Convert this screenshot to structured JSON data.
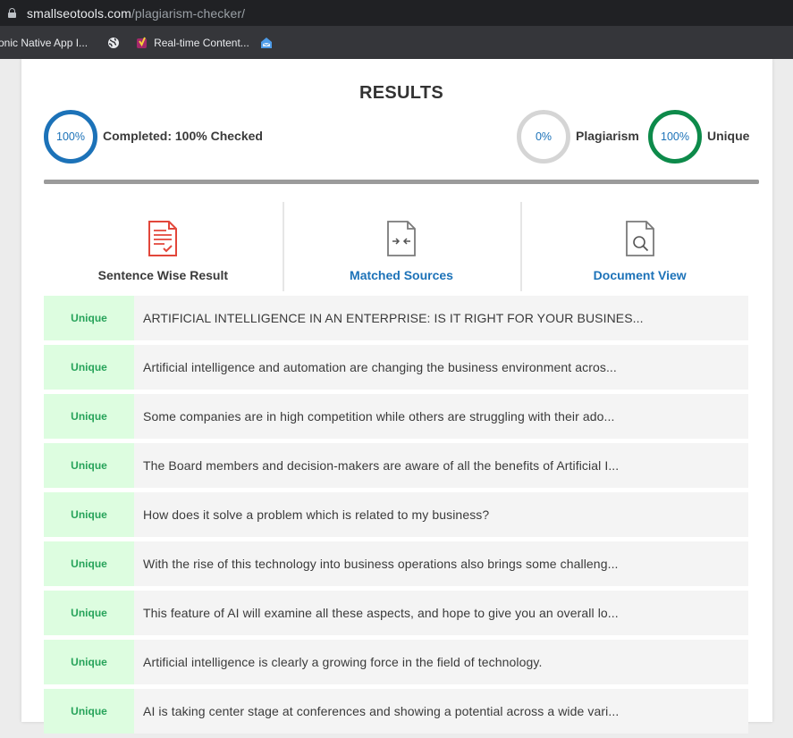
{
  "browser": {
    "url_host": "smallseotools.com",
    "url_path": "/plagiarism-checker/",
    "bookmarks": [
      {
        "label": "onic Native App I...",
        "icon": "none"
      },
      {
        "label": "",
        "icon": "globe-icon"
      },
      {
        "label": "Real-time Content...",
        "icon": "yoast-icon"
      },
      {
        "label": "",
        "icon": "inbox-icon"
      }
    ]
  },
  "results": {
    "title": "RESULTS",
    "completed": {
      "percent_text": "100%",
      "label": "Completed: 100% Checked"
    },
    "plagiarism": {
      "percent_text": "0%",
      "label": "Plagiarism"
    },
    "unique": {
      "percent_text": "100%",
      "label": "Unique"
    },
    "progress": 1.0
  },
  "tabs": [
    {
      "label": "Sentence Wise Result",
      "icon": "document-check-icon",
      "active": true
    },
    {
      "label": "Matched Sources",
      "icon": "document-compare-icon",
      "active": false
    },
    {
      "label": "Document View",
      "icon": "document-search-icon",
      "active": false
    }
  ],
  "rows": [
    {
      "status": "Unique",
      "text": "ARTIFICIAL INTELLIGENCE IN AN ENTERPRISE: IS IT RIGHT FOR YOUR BUSINES..."
    },
    {
      "status": "Unique",
      "text": "Artificial intelligence and automation are changing the business environment acros..."
    },
    {
      "status": "Unique",
      "text": "Some companies are in high competition while others are struggling with their ado..."
    },
    {
      "status": "Unique",
      "text": "The Board members and decision-makers are aware of all the benefits of Artificial I..."
    },
    {
      "status": "Unique",
      "text": "How does it solve a problem which is related to my business?"
    },
    {
      "status": "Unique",
      "text": "With the rise of this technology into business operations also brings some challeng..."
    },
    {
      "status": "Unique",
      "text": "This feature of AI will examine all these aspects, and hope to give you an overall lo..."
    },
    {
      "status": "Unique",
      "text": "Artificial intelligence is clearly a growing force in the field of technology."
    },
    {
      "status": "Unique",
      "text": "AI is taking center stage at conferences and showing a potential across a wide vari..."
    }
  ],
  "colors": {
    "accent_blue": "#1c72b8",
    "unique_green": "#0d8a4a",
    "badge_bg": "#ddfde0",
    "badge_text": "#27a35a",
    "tab_icon_red": "#e2463a"
  }
}
